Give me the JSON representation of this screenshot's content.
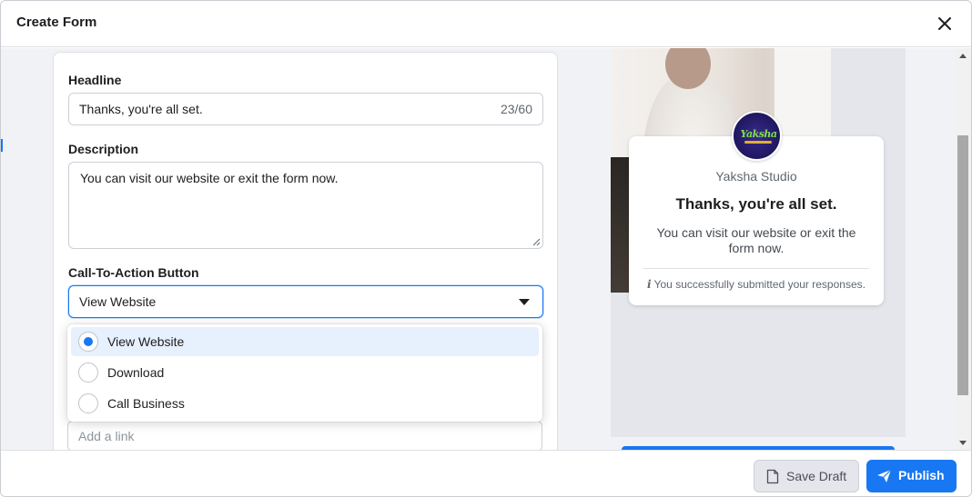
{
  "header": {
    "title": "Create Form",
    "close_icon": "close-icon"
  },
  "form": {
    "headline": {
      "label": "Headline",
      "value": "Thanks, you're all set.",
      "counter": "23/60"
    },
    "description": {
      "label": "Description",
      "value": "You can visit our website or exit the form now."
    },
    "cta": {
      "label": "Call-To-Action Button",
      "selected": "View Website",
      "options": [
        {
          "label": "View Website",
          "selected": true
        },
        {
          "label": "Download",
          "selected": false
        },
        {
          "label": "Call Business",
          "selected": false
        }
      ]
    },
    "link": {
      "placeholder": "Add a link"
    }
  },
  "preview": {
    "business_name": "Yaksha Studio",
    "logo_text": "Yaksha",
    "title": "Thanks, you're all set.",
    "description": "You can visit our website or exit the form now.",
    "note_icon": "i",
    "note": "You successfully submitted your responses."
  },
  "footer": {
    "save_draft": "Save Draft",
    "publish": "Publish"
  },
  "colors": {
    "accent": "#1877f2",
    "text": "#1c1e21",
    "muted": "#606770"
  }
}
